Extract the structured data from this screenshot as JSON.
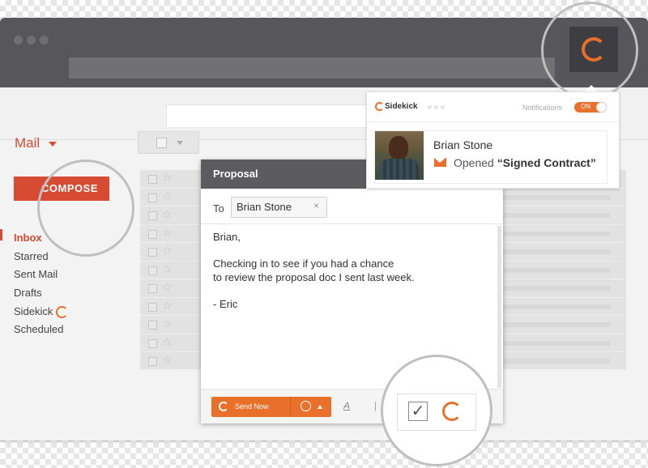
{
  "gmail": {
    "mail_label": "Mail",
    "compose_label": "COMPOSE",
    "nav": [
      "Inbox",
      "Starred",
      "Sent Mail",
      "Drafts",
      "Sidekick",
      "Scheduled"
    ]
  },
  "compose": {
    "title": "Proposal",
    "to_label": "To",
    "recipient": "Brian Stone",
    "remove_glyph": "×",
    "body": "Brian,\n\nChecking in to see if you had a chance\nto review the proposal doc I sent last week.\n\n- Eric",
    "send_label": "Send Now",
    "format_glyph": "A"
  },
  "sidekick": {
    "brand": "Sidekick",
    "notifications_label": "Notifications",
    "toggle_label": "ON",
    "notification": {
      "name": "Brian Stone",
      "action": "Opened",
      "document": "“Signed Contract”"
    }
  },
  "icons": {
    "brand_color": "#e8702a",
    "accent_red": "#d64b32",
    "list": [
      "sidekick-logo-icon",
      "star-icon",
      "checkbox-icon",
      "clock-icon",
      "envelope-icon",
      "paperclip-icon",
      "text-format-icon",
      "chevron-down-icon"
    ]
  }
}
